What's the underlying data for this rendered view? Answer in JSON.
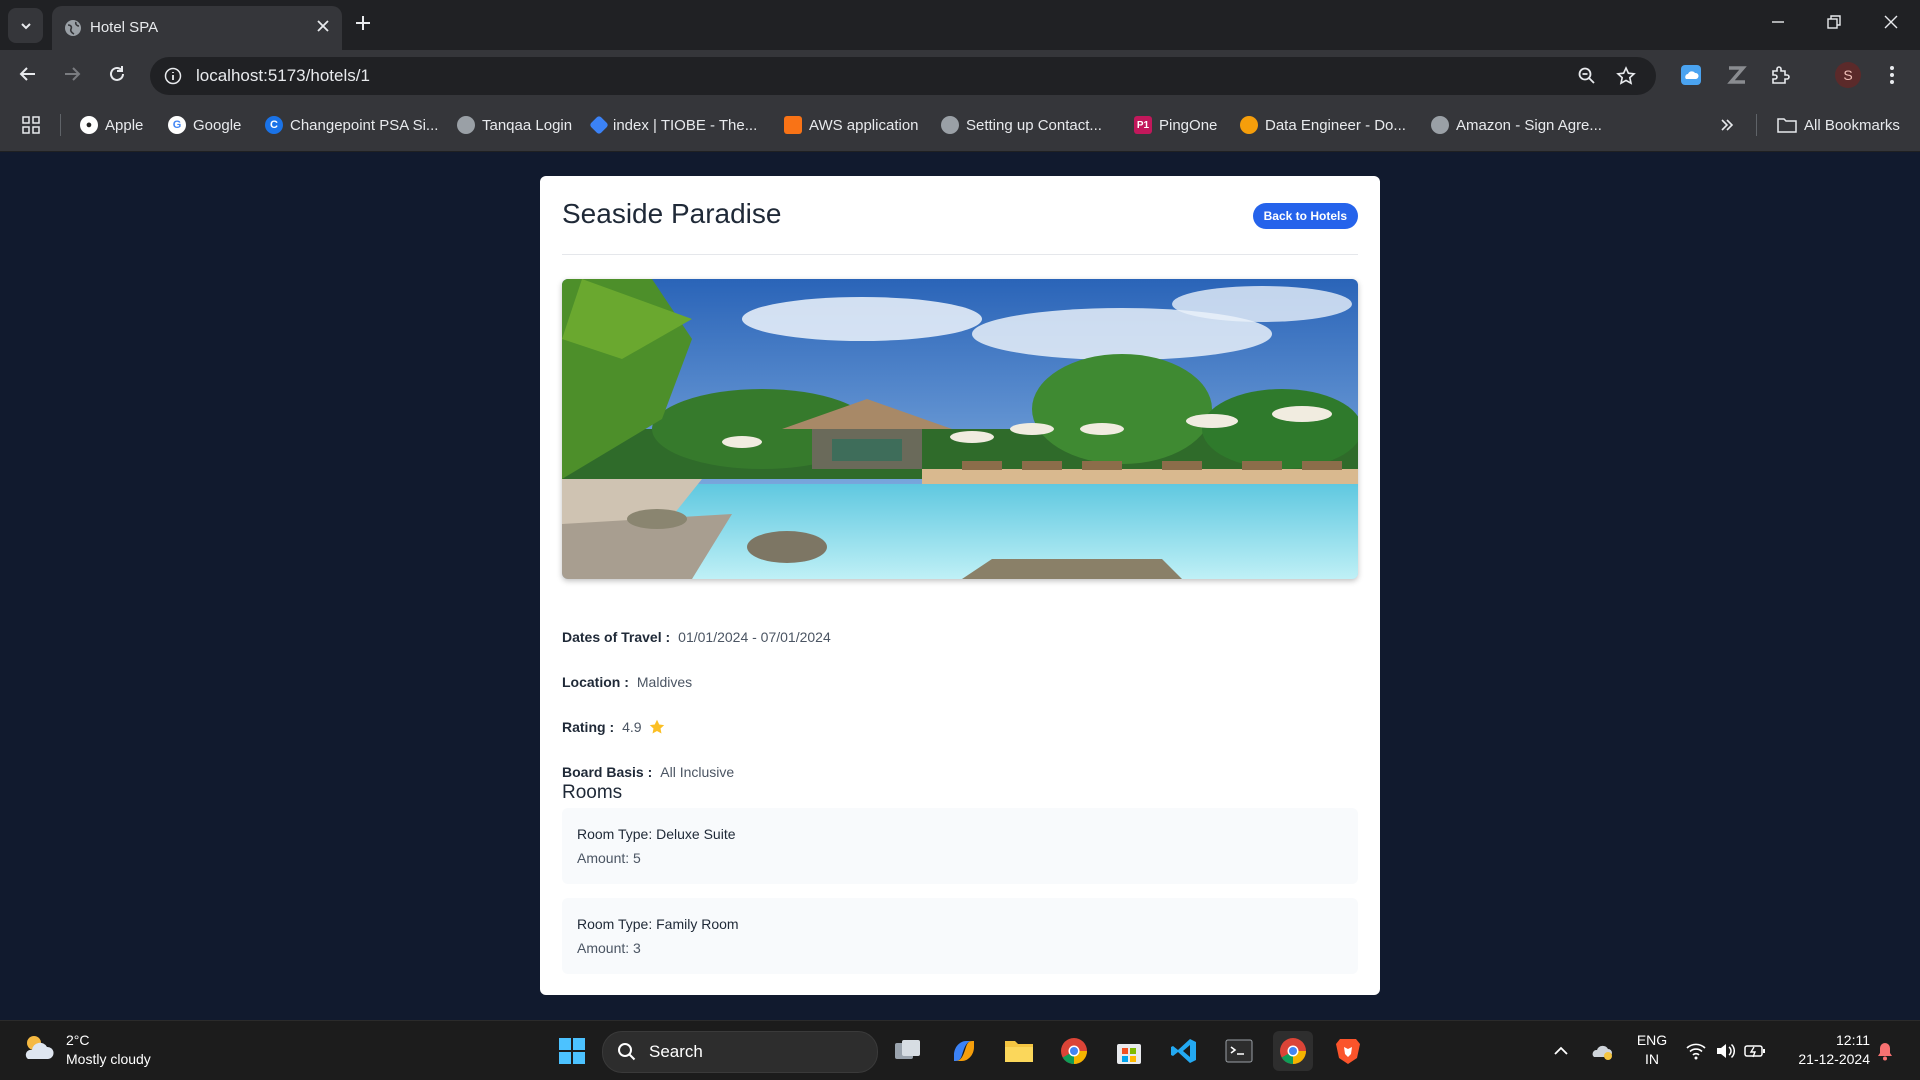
{
  "browser": {
    "tab_title": "Hotel SPA",
    "url": "localhost:5173/hotels/1",
    "profile_initial": "S"
  },
  "bookmarks": [
    {
      "label": "Apple",
      "icon": "apple-icon",
      "color": "#ffffff"
    },
    {
      "label": "Google",
      "icon": "google-icon",
      "color": "#4285f4"
    },
    {
      "label": "Changepoint PSA Si...",
      "icon": "changepoint-icon",
      "color": "#1a73e8"
    },
    {
      "label": "Tanqaa Login",
      "icon": "globe-icon",
      "color": "#9aa0a6"
    },
    {
      "label": "index | TIOBE - The...",
      "icon": "tiobe-icon",
      "color": "#3b82f6"
    },
    {
      "label": "AWS application",
      "icon": "aws-icon",
      "color": "#f97316"
    },
    {
      "label": "Setting up Contact...",
      "icon": "globe-icon",
      "color": "#9aa0a6"
    },
    {
      "label": "PingOne",
      "icon": "pingone-icon",
      "color": "#c2185b"
    },
    {
      "label": "Data Engineer - Do...",
      "icon": "data-engineer-icon",
      "color": "#f59e0b"
    },
    {
      "label": "Amazon - Sign Agre...",
      "icon": "globe-icon",
      "color": "#9aa0a6"
    }
  ],
  "all_bookmarks_label": "All Bookmarks",
  "hotel": {
    "name": "Seaside Paradise",
    "back_label": "Back to Hotels",
    "dates_label": "Dates of Travel :",
    "dates_value": "01/01/2024 - 07/01/2024",
    "location_label": "Location :",
    "location_value": "Maldives",
    "rating_label": "Rating :",
    "rating_value": "4.9",
    "board_label": "Board Basis :",
    "board_value": "All Inclusive",
    "rooms_heading": "Rooms",
    "rooms": [
      {
        "type": "Room Type: Deluxe Suite",
        "amount": "Amount: 5"
      },
      {
        "type": "Room Type: Family Room",
        "amount": "Amount: 3"
      }
    ]
  },
  "taskbar": {
    "temperature": "2°C",
    "weather": "Mostly cloudy",
    "search_label": "Search",
    "language": "ENG",
    "region": "IN",
    "time": "12:11",
    "date": "21-12-2024"
  },
  "colors": {
    "page_background": "#111a2e",
    "accent_button": "#2563eb",
    "rating_star": "#fbbf24"
  }
}
